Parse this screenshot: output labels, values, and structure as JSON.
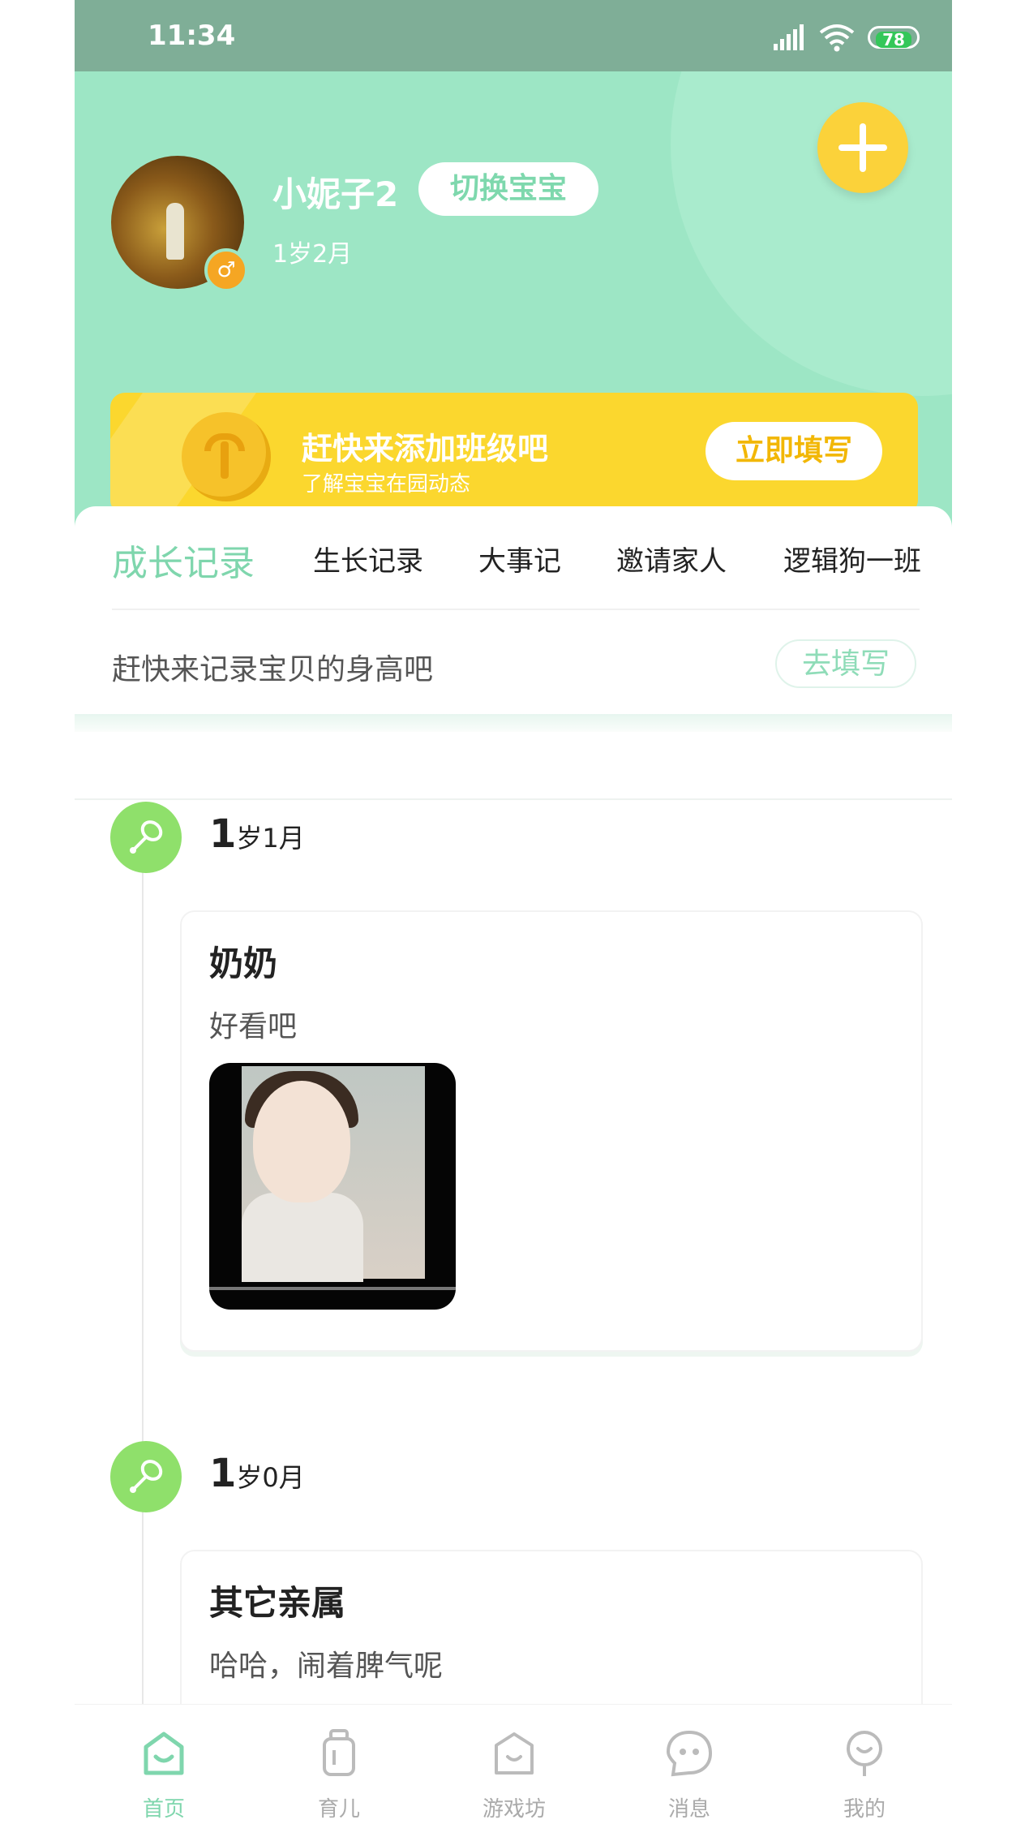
{
  "status_bar": {
    "time": "11:34",
    "battery": "78"
  },
  "profile": {
    "name": "小妮子2",
    "switch_label": "切换宝宝",
    "age": "1岁2月",
    "gender_symbol": "♂"
  },
  "banner": {
    "title": "赶快来添加班级吧",
    "subtitle": "了解宝宝在园动态",
    "button": "立即填写"
  },
  "tabs": [
    "成长记录",
    "生长记录",
    "大事记",
    "邀请家人",
    "逻辑狗一班"
  ],
  "height_prompt": {
    "text": "赶快来记录宝贝的身高吧",
    "button": "去填写"
  },
  "timeline": [
    {
      "age_num": "1",
      "age_rest": "岁1月",
      "author": "奶奶",
      "text": "好看吧",
      "has_photo": true
    },
    {
      "age_num": "1",
      "age_rest": "岁0月",
      "author": "其它亲属",
      "text": "哈哈，闹着脾气呢",
      "has_photo": false
    }
  ],
  "bottom_nav": [
    {
      "label": "首页",
      "icon": "home-icon",
      "active": true
    },
    {
      "label": "育儿",
      "icon": "bottle-icon",
      "active": false
    },
    {
      "label": "游戏坊",
      "icon": "game-icon",
      "active": false
    },
    {
      "label": "消息",
      "icon": "message-icon",
      "active": false
    },
    {
      "label": "我的",
      "icon": "profile-icon",
      "active": false
    }
  ],
  "colors": {
    "accent": "#7fd6ad",
    "header": "#9de6c5",
    "banner": "#fbd72e",
    "plus": "#fbd23a"
  }
}
